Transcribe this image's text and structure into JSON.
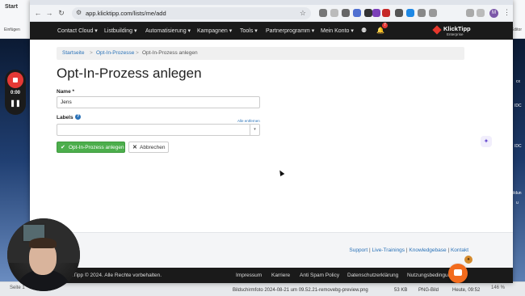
{
  "background_app": {
    "tab_start": "Start",
    "einfuegen": "Einfügen",
    "editor": "Editor",
    "status_left": "Seite 1",
    "status_right": "146 %",
    "finder_file": "Bildschirmfoto 2024-08-21 um 09.52.21-removebg-preview.png",
    "finder_size": "53 KB",
    "finder_kind": "PNG-Bild",
    "finder_date": "Heute, 09:52",
    "desk_labels": [
      "cx",
      "IDC",
      "IDC",
      "ildun",
      "u"
    ]
  },
  "browser": {
    "url": "app.klicktipp.com/lists/me/add",
    "profile_initial": "M",
    "notification_count": "7"
  },
  "nav": {
    "items": [
      "Contact Cloud ▾",
      "Listbuilding ▾",
      "Automatisierung ▾",
      "Kampagnen ▾",
      "Tools ▾",
      "Partnerprogramm ▾",
      "Mein Konto ▾"
    ],
    "logo_text": "KlickTipp",
    "logo_sub": "Enterprise"
  },
  "breadcrumb": {
    "home": "Startseite",
    "parent": "Opt-In-Prozesse",
    "current": "Opt-In-Prozess anlegen",
    "sep": ">"
  },
  "form": {
    "title": "Opt-In-Prozess anlegen",
    "name_label": "Name *",
    "name_value": "Jens",
    "labels_label": "Labels",
    "remove_all": "Alle entfernen",
    "submit_label": "Opt-In-Prozess anlegen",
    "cancel_label": "Abbrechen"
  },
  "footer": {
    "links": [
      "Support",
      "Live-Trainings",
      "Knowledgebase",
      "Kontakt"
    ],
    "copyright": "KlickTipp © 2024. Alle Rechte vorbehalten.",
    "bottom_links": [
      "Impressum",
      "Karriere",
      "Anti Spam Policy",
      "Datenschutzerklärung",
      "Nutzungsbedingungen"
    ]
  },
  "recorder": {
    "time": "0:00"
  },
  "colors": {
    "nav_bg": "#1a1a1a",
    "primary_green": "#4cae4c",
    "link_blue": "#2a72b8",
    "record_red": "#e53935",
    "chat_orange": "#f26b1d"
  }
}
